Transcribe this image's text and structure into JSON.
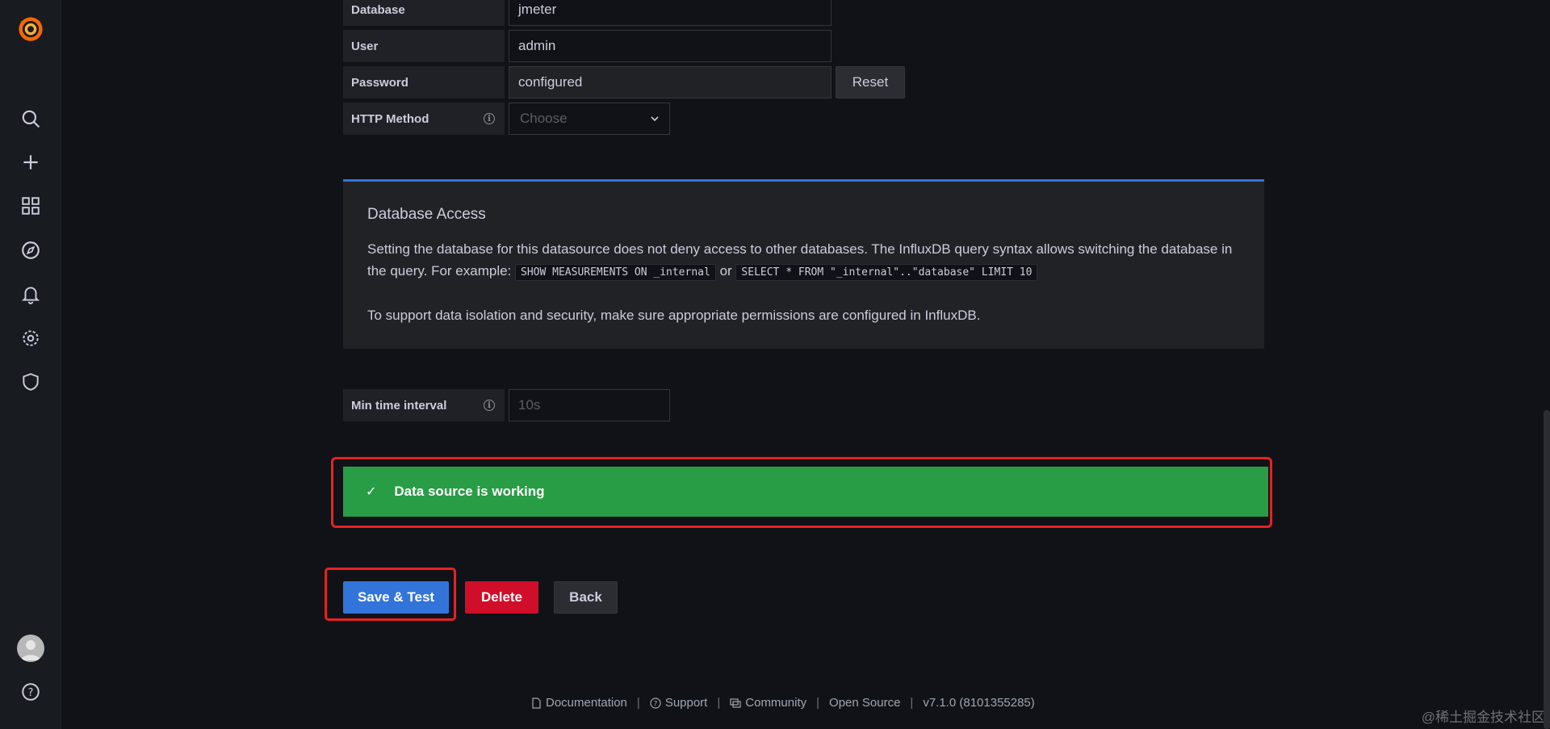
{
  "sidebar": {
    "icons": [
      "grafana-logo",
      "search-icon",
      "plus-icon",
      "dashboards-icon",
      "explore-icon",
      "alerting-icon",
      "configuration-icon",
      "server-admin-icon",
      "avatar",
      "help-icon"
    ]
  },
  "form": {
    "database": {
      "label": "Database",
      "value": "jmeter"
    },
    "user": {
      "label": "User",
      "value": "admin"
    },
    "password": {
      "label": "Password",
      "value": "configured",
      "reset_label": "Reset"
    },
    "http_method": {
      "label": "HTTP Method",
      "placeholder": "Choose"
    },
    "min_time_interval": {
      "label": "Min time interval",
      "placeholder": "10s"
    }
  },
  "info_box": {
    "title": "Database Access",
    "text_1a": "Setting the database for this datasource does not deny access to other databases. The InfluxDB query syntax allows switching the database in the query. For example:",
    "code_1": "SHOW MEASUREMENTS ON _internal",
    "text_or": "or",
    "code_2": "SELECT * FROM \"_internal\"..\"database\" LIMIT 10",
    "text_2": "To support data isolation and security, make sure appropriate permissions are configured in InfluxDB."
  },
  "alert": {
    "message": "Data source is working",
    "status_color": "#299c46"
  },
  "buttons": {
    "save_test": "Save & Test",
    "delete": "Delete",
    "back": "Back"
  },
  "footer": {
    "documentation": "Documentation",
    "support": "Support",
    "community": "Community",
    "open_source": "Open Source",
    "version": "v7.1.0 (8101355285)"
  },
  "watermark": "@稀土掘金技术社区",
  "colors": {
    "accent": "#3274d9",
    "danger": "#d10e29",
    "success": "#299c46",
    "highlight": "#e62222"
  }
}
